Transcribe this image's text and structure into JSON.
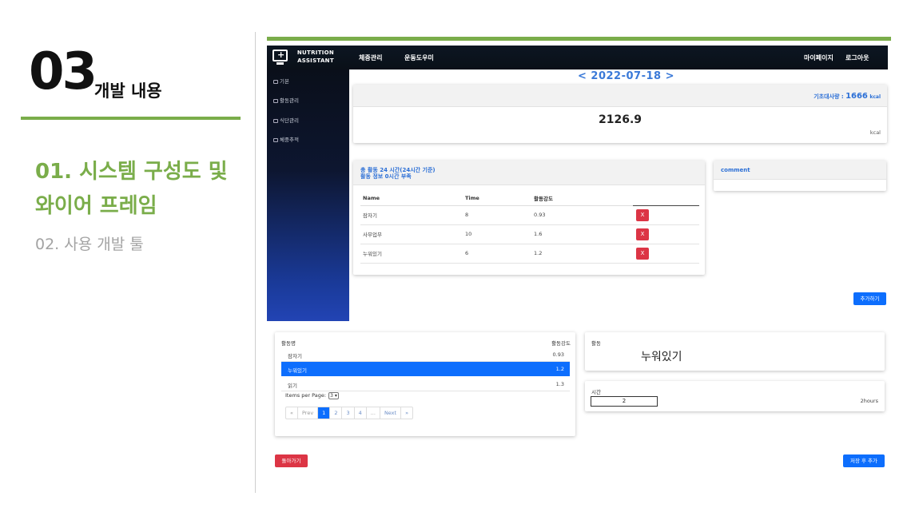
{
  "slide": {
    "number": "03",
    "title": "개발 내용",
    "section1_line1": "01. 시스템 구성도 및",
    "section1_line2": "와이어 프레임",
    "section2": "02. 사용 개발 툴"
  },
  "app": {
    "brand_line1": "NUTRITION",
    "brand_line2": "ASSISTANT",
    "nav": [
      "체중관리",
      "운동도우미"
    ],
    "nav_right": [
      "마이페이지",
      "로그아웃"
    ]
  },
  "sidebar": {
    "items": [
      "기본",
      "활동관리",
      "식단관리",
      "체중추적"
    ]
  },
  "main": {
    "date": "< 2022-07-18 >",
    "bmr_label": "기초대사량 : ",
    "bmr_value": "1666",
    "bmr_unit": "kcal",
    "total_kcal": "2126.9",
    "total_unit": "kcal",
    "activity_summary_line1": "총 활동 24 시간(24시간 기준)",
    "activity_summary_line2": "활동 정보 0시간 부족",
    "table_headers": [
      "Name",
      "Time",
      "활동강도"
    ],
    "activities": [
      {
        "name": "잠자기",
        "time": "8",
        "intensity": "0.93"
      },
      {
        "name": "사무업무",
        "time": "10",
        "intensity": "1.6"
      },
      {
        "name": "누워있기",
        "time": "6",
        "intensity": "1.2"
      }
    ],
    "delete_label": "X",
    "comment_title": "comment",
    "add_button": "추가하기"
  },
  "picker": {
    "header_name": "활동명",
    "header_intensity": "활동강도",
    "items": [
      {
        "name": "잠자기",
        "intensity": "0.93",
        "selected": false
      },
      {
        "name": "누워있기",
        "intensity": "1.2",
        "selected": true
      },
      {
        "name": "읽기",
        "intensity": "1.3",
        "selected": false
      }
    ],
    "items_per_page_label": "Items per Page:",
    "items_per_page_value": "3",
    "pager": [
      "«",
      "Prev",
      "1",
      "2",
      "3",
      "4",
      "...",
      "Next",
      "»"
    ],
    "active_page": "1"
  },
  "form": {
    "activity_label": "활동",
    "activity_value": "누워있기",
    "time_label": "시간",
    "time_value": "2",
    "time_unit": "2hours",
    "back_button": "돌아가기",
    "save_button": "저장 후 추가"
  },
  "colors": {
    "accent_green": "#7aad4a",
    "primary_blue": "#0d6efd",
    "danger_red": "#dc3545",
    "navbar_dark": "#0c1622"
  }
}
